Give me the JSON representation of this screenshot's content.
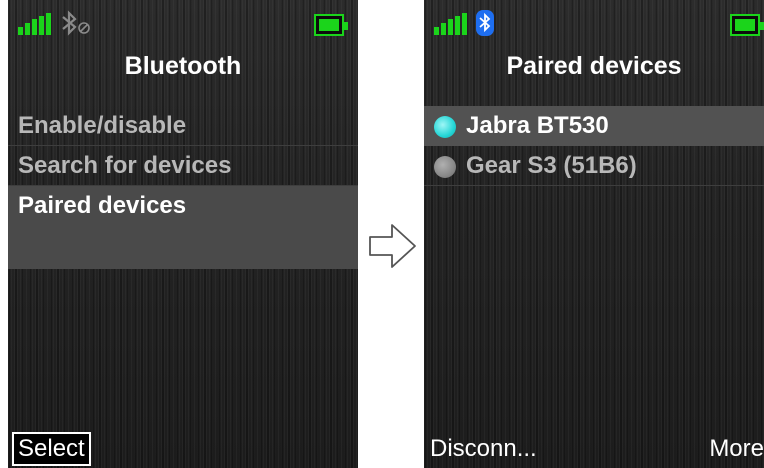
{
  "left_screen": {
    "title": "Bluetooth",
    "menu": [
      {
        "label": "Enable/disable"
      },
      {
        "label": "Search for devices"
      },
      {
        "label": "Paired devices"
      }
    ],
    "softkey_left": "Select",
    "bluetooth_state": "disabled"
  },
  "right_screen": {
    "title": "Paired devices",
    "devices": [
      {
        "label": "Jabra BT530",
        "connected": true
      },
      {
        "label": "Gear S3 (51B6)",
        "connected": false
      }
    ],
    "softkey_left": "Disconn...",
    "softkey_right": "More",
    "bluetooth_state": "enabled"
  },
  "colors": {
    "signal": "#1bd41b",
    "battery": "#1bd41b",
    "bt_active": "#1e6ef0",
    "radio_active": "#24d6d6"
  },
  "icons": {
    "transition": "arrow-right-icon"
  }
}
